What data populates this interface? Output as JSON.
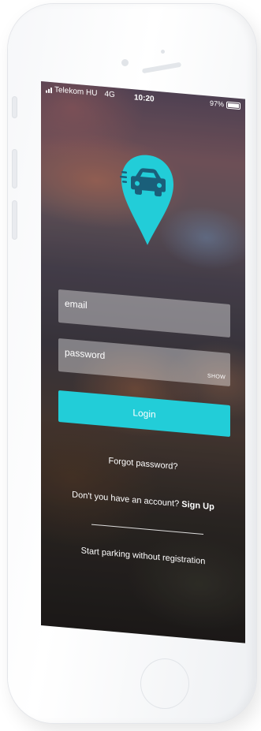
{
  "status_bar": {
    "carrier": "Telekom HU",
    "network": "4G",
    "time": "10:20",
    "battery": "97%"
  },
  "login_form": {
    "email_placeholder": "email",
    "password_placeholder": "password",
    "show_label": "SHOW",
    "login_label": "Login"
  },
  "links": {
    "forgot_password": "Forgot password?",
    "no_account": "Don't you have an account?",
    "sign_up": "Sign Up",
    "start_parking": "Start parking without registration"
  },
  "colors": {
    "accent": "#22cdd8",
    "logo_pin": "#22cdd8",
    "car_glyph": "#1a5f7a",
    "text": "#ffffff"
  },
  "icons": {
    "logo": "car-location-pin-icon",
    "signal": "signal-bars-icon",
    "battery": "battery-icon"
  }
}
